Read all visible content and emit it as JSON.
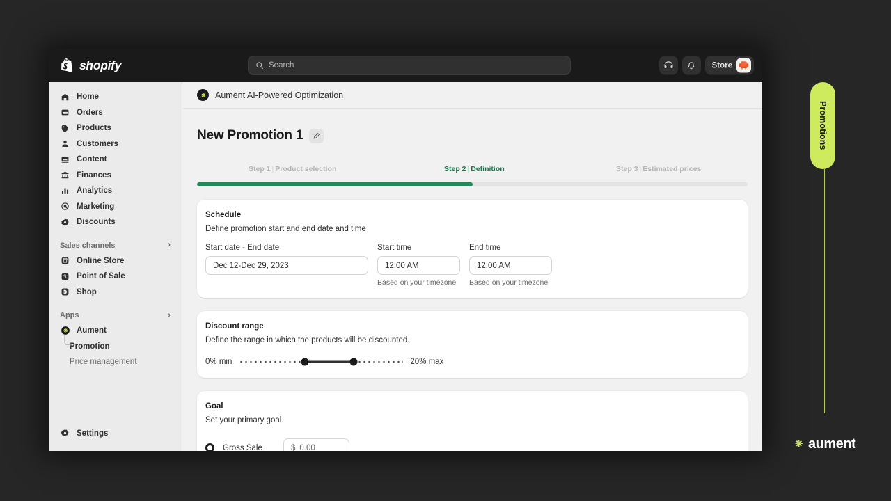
{
  "topbar": {
    "brand": "shopify",
    "brand_icon": "shopify-bag-icon",
    "search": {
      "icon": "search-icon",
      "placeholder": "Search",
      "value": ""
    },
    "help_icon": "support-agent-icon",
    "notifications_icon": "bell-icon",
    "store": {
      "label": "Store",
      "avatar_icon": "armchair-avatar-icon"
    }
  },
  "sidebar": {
    "items": [
      {
        "label": "Home",
        "icon": "home-icon"
      },
      {
        "label": "Orders",
        "icon": "orders-inbox-icon"
      },
      {
        "label": "Products",
        "icon": "product-tag-icon"
      },
      {
        "label": "Customers",
        "icon": "customer-person-icon"
      },
      {
        "label": "Content",
        "icon": "content-media-icon"
      },
      {
        "label": "Finances",
        "icon": "finances-bank-icon"
      },
      {
        "label": "Analytics",
        "icon": "analytics-bars-icon"
      },
      {
        "label": "Marketing",
        "icon": "marketing-target-icon"
      },
      {
        "label": "Discounts",
        "icon": "discount-badge-icon"
      }
    ],
    "sales_channels": {
      "label": "Sales channels",
      "chevron": "›",
      "items": [
        {
          "label": "Online Store",
          "icon": "online-store-icon"
        },
        {
          "label": "Point of Sale",
          "icon": "point-of-sale-icon"
        },
        {
          "label": "Shop",
          "icon": "shop-icon"
        }
      ]
    },
    "apps": {
      "label": "Apps",
      "chevron": "›",
      "items": [
        {
          "label": "Aument",
          "icon": "aument-app-icon"
        }
      ],
      "sub_items": [
        {
          "label": "Promotion",
          "selected": true
        },
        {
          "label": "Price management",
          "selected": false
        }
      ]
    },
    "settings": {
      "label": "Settings",
      "icon": "gear-icon"
    }
  },
  "app_header": {
    "icon": "aument-app-icon",
    "title": "Aument AI-Powered Optimization"
  },
  "page": {
    "title": "New Promotion 1",
    "edit_icon": "pencil-icon"
  },
  "stepper": {
    "progress_percent": 50,
    "steps": [
      {
        "num": "Step 1",
        "sep": "|",
        "label": "Product selection",
        "active": false
      },
      {
        "num": "Step 2",
        "sep": "|",
        "label": "Definition",
        "active": true
      },
      {
        "num": "Step 3",
        "sep": "|",
        "label": "Estimated prices",
        "active": false
      }
    ]
  },
  "schedule": {
    "title": "Schedule",
    "description": "Define promotion start and end date and time",
    "date_label": "Start date - End date",
    "date_value": "Dec 12-Dec 29, 2023",
    "start_time_label": "Start time",
    "start_time_value": "12:00 AM",
    "start_time_hint": "Based on your timezone",
    "end_time_label": "End time",
    "end_time_value": "12:00 AM",
    "end_time_hint": "Based on your timezone"
  },
  "discount_range": {
    "title": "Discount range",
    "description": "Define the range in which the products will be discounted.",
    "min_label": "0% min",
    "max_label": "20% max",
    "min_value": 0,
    "max_value": 20
  },
  "goal": {
    "title": "Goal",
    "description": "Set your primary goal.",
    "option_label": "Gross Sale",
    "option_selected": true,
    "currency_symbol": "$",
    "amount_value": "0.00"
  },
  "rail": {
    "label": "Promotions"
  },
  "wordmark": {
    "text": "aument",
    "icon": "aument-asterisk-icon"
  },
  "colors": {
    "accent_green": "#218858",
    "accent_lime": "#cdeb5c",
    "topbar_bg": "#1a1a1a",
    "sidebar_bg": "#ebebeb",
    "canvas_bg": "#f1f1f1",
    "backdrop": "#262626"
  }
}
